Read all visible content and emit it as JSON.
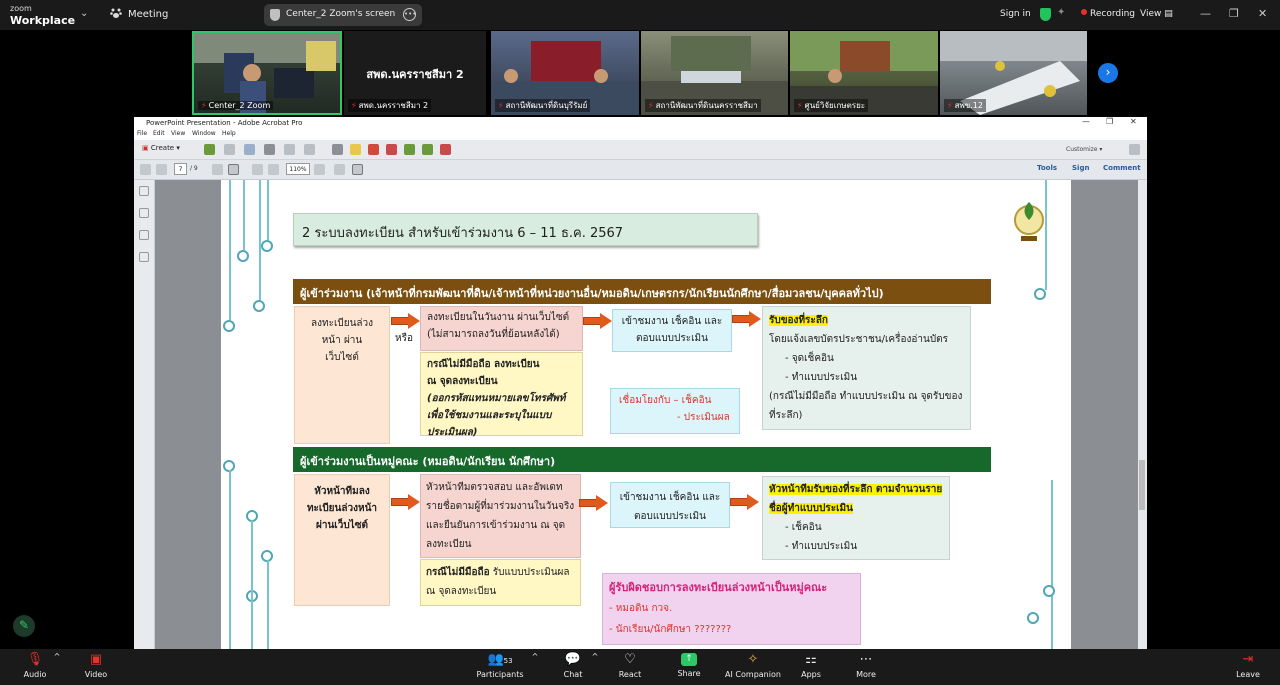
{
  "zoom": {
    "logo_line1": "zoom",
    "logo_line2": "Workplace",
    "meeting_label": "Meeting",
    "share_label": "Center_2 Zoom's screen",
    "signin_label": "Sign in",
    "recording_label": "Recording",
    "view_label": "View",
    "participants_count": "53",
    "bottom": {
      "audio": "Audio",
      "video": "Video",
      "participants": "Participants",
      "chat": "Chat",
      "react": "React",
      "share": "Share",
      "ai": "AI Companion",
      "apps": "Apps",
      "more": "More",
      "leave": "Leave"
    }
  },
  "tiles": {
    "t1_name": "Center_2 Zoom",
    "t2_big": "สพด.นครราชสีมา 2",
    "t2_name": "สพด.นครราชสีมา 2",
    "t3_name": "สถานีพัฒนาที่ดินบุรีรัมย์",
    "t4_name": "สถานีพัฒนาที่ดินนครราชสีมา",
    "t5_name": "ศูนย์วิจัยเกษตรยะ",
    "t6_name": "สพข.12"
  },
  "acrobat": {
    "title": "PowerPoint Presentation - Adobe Acrobat Pro",
    "menu": [
      "File",
      "Edit",
      "View",
      "Window",
      "Help"
    ],
    "create": "Create",
    "customize": "Customize",
    "page_current": "7",
    "page_total": "/ 9",
    "zoom": "110%",
    "tools": "Tools",
    "sign": "Sign",
    "comment": "Comment"
  },
  "slide": {
    "title": "2 ระบบลงทะเบียน สำหรับเข้าร่วมงาน 6 – 11 ธ.ค. 2567",
    "hdr1": "ผู้เข้าร่วมงาน (เจ้าหน้าที่กรมพัฒนาที่ดิน/เจ้าหน้าที่หน่วยงานอื่น/หมอดิน/เกษตรกร/นักเรียนนักศึกษา/สื่อมวลชน/บุคคลทั่วไป)",
    "s1_box1": "ลงทะเบียนล่วงหน้า ผ่านเว็บไซต์",
    "s1_or": "หรือ",
    "s1_box2_l1": "ลงทะเบียนในวันงาน ผ่านเว็บไซต์",
    "s1_box2_l2": "(ไม่สามารถลงวันที่ย้อนหลังได้)",
    "s1_box3_l1": "กรณีไม่มีมือถือ ลงทะเบียน",
    "s1_box3_l2": "ณ จุดลงทะเบียน",
    "s1_box3_l3": "(ออกรหัสแทนหมายเลขโทรศัพท์ เพื่อใช้ชมงานและระบุในแบบประเมินผล)",
    "s1_box4": "เข้าชมงาน เช็คอิน และตอบแบบประเมิน",
    "s1_link_l1": "เชื่อมโยงกับ – เช็คอิน",
    "s1_link_l2": "- ประเมินผล",
    "s1_box5_head": "รับของที่ระลึก",
    "s1_box5_l1": "โดยแจ้งเลขบัตรประชาชน/เครื่องอ่านบัตร",
    "s1_box5_l2": "- จุดเช็คอิน",
    "s1_box5_l3": "- ทำแบบประเมิน",
    "s1_box5_l4": "(กรณีไม่มีมือถือ ทำแบบประเมิน ณ จุดรับของที่ระลึก)",
    "hdr2": "ผู้เข้าร่วมงานเป็นหมู่คณะ (หมอดิน/นักเรียน นักศึกษา)",
    "s2_box1": "หัวหน้าทีมลงทะเบียนล่วงหน้าผ่านเว็บไซต์",
    "s2_box2": "หัวหน้าทีมตรวจสอบ และอัพเดทรายชื่อตามผู้ที่มาร่วมงานในวันจริง และยืนยันการเข้าร่วมงาน ณ จุดลงทะเบียน",
    "s2_box3_bold": "กรณีไม่มีมือถือ",
    "s2_box3_rest": " รับแบบประเมินผล ณ จุดลงทะเบียน",
    "s2_box4": "เข้าชมงาน เช็คอิน และตอบแบบประเมิน",
    "s2_box5_head": "หัวหน้าทีมรับของที่ระลึก ตามจำนวนรายชื่อผู้ทำแบบประเมิน",
    "s2_box5_l1": "- เช็คอิน",
    "s2_box5_l2": "- ทำแบบประเมิน",
    "s2_resp_head": "ผู้รับผิดชอบการลงทะเบียนล่วงหน้าเป็นหมู่คณะ",
    "s2_resp_l1": "- หมอดิน  กวจ.",
    "s2_resp_l2": "- นักเรียน/นักศึกษา  ???????"
  }
}
